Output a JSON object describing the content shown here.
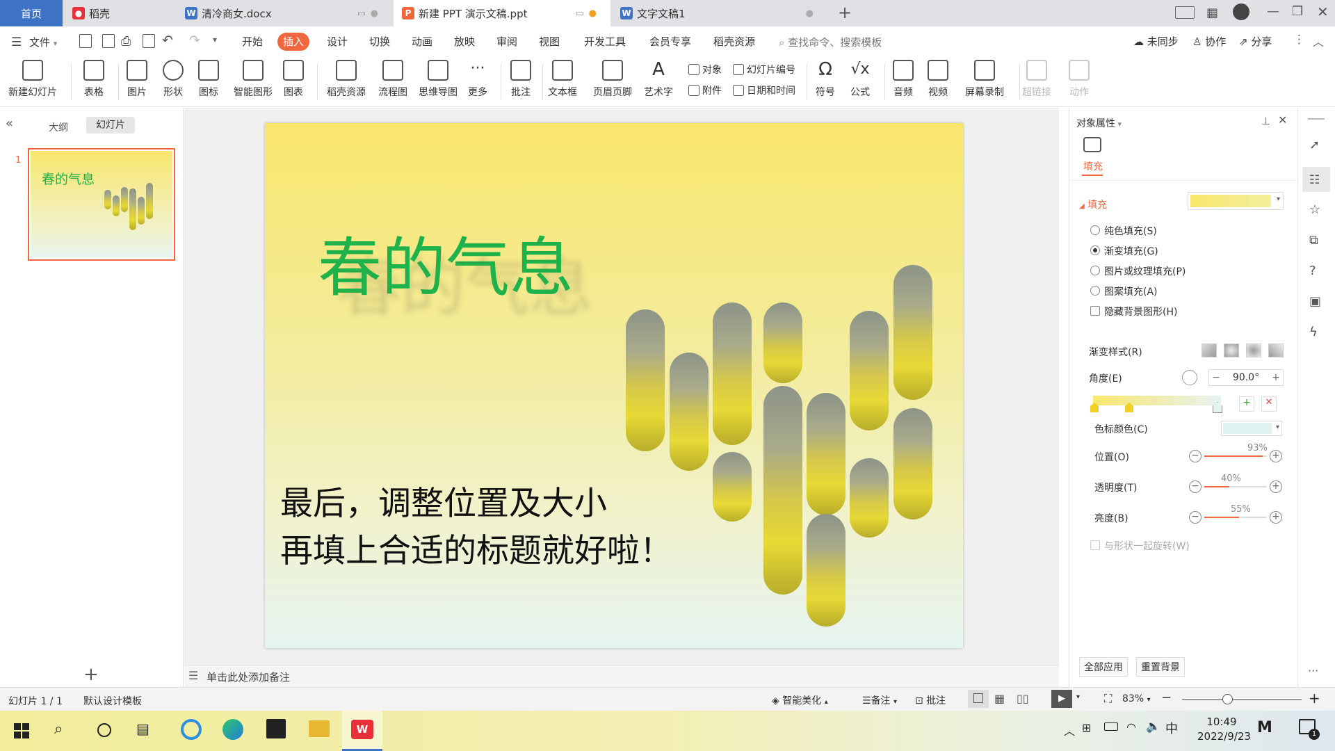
{
  "tabs": {
    "home": "首页",
    "daoke": "稻壳",
    "doc1": "清冷商女.docx",
    "ppt": "新建 PPT 演示文稿.ppt",
    "doc2": "文字文稿1"
  },
  "menu": {
    "file": "文件",
    "items": [
      "开始",
      "插入",
      "设计",
      "切换",
      "动画",
      "放映",
      "审阅",
      "视图",
      "开发工具",
      "会员专享",
      "稻壳资源"
    ],
    "search": "查找命令、搜索模板",
    "sync": "未同步",
    "collab": "协作",
    "share": "分享"
  },
  "ribbon": {
    "new_slide": "新建幻灯片",
    "table": "表格",
    "picture": "图片",
    "shape": "形状",
    "icon": "图标",
    "smart": "智能图形",
    "chart": "图表",
    "daoke": "稻壳资源",
    "flow": "流程图",
    "mind": "思维导图",
    "more": "更多",
    "comment": "批注",
    "textbox": "文本框",
    "header": "页眉页脚",
    "art": "艺术字",
    "object": "对象",
    "slide_num": "幻灯片编号",
    "attach": "附件",
    "datetime": "日期和时间",
    "symbol": "符号",
    "formula": "公式",
    "audio": "音频",
    "video": "视频",
    "record": "屏幕录制",
    "hyperlink": "超链接",
    "action": "动作"
  },
  "leftpanel": {
    "outline": "大纲",
    "slides": "幻灯片",
    "slide_number": "1",
    "thumb_title": "春的气息"
  },
  "slide": {
    "title": "春的气息",
    "line1": "最后，调整位置及大小",
    "line2": "再填上合适的标题就好啦！"
  },
  "notes": "单击此处添加备注",
  "props": {
    "header": "对象属性",
    "tab_fill": "填充",
    "section_fill": "填充",
    "solid": "纯色填充(S)",
    "gradient": "渐变填充(G)",
    "picture": "图片或纹理填充(P)",
    "pattern": "图案填充(A)",
    "hide_bg": "隐藏背景图形(H)",
    "gradient_style": "渐变样式(R)",
    "angle_label": "角度(E)",
    "angle_value": "90.0°",
    "stop_color": "色标颜色(C)",
    "position_label": "位置(O)",
    "position_value": "93%",
    "position_fraction": 0.93,
    "transparency_label": "透明度(T)",
    "transparency_value": "40%",
    "transparency_fraction": 0.4,
    "brightness_label": "亮度(B)",
    "brightness_value": "55%",
    "brightness_fraction": 0.55,
    "rotate_with": "与形状一起旋转(W)",
    "apply_all": "全部应用",
    "reset_bg": "重置背景"
  },
  "status": {
    "slide_count": "幻灯片 1 / 1",
    "template": "默认设计模板",
    "beautify": "智能美化",
    "notes": "备注",
    "comment": "批注",
    "zoom": "83%"
  },
  "taskbar": {
    "ime": "中",
    "time": "10:49",
    "date": "2022/9/23"
  },
  "colors": {
    "accent": "#f0663e",
    "home_tab": "#3d72c4",
    "title_green": "#1fb24a"
  }
}
